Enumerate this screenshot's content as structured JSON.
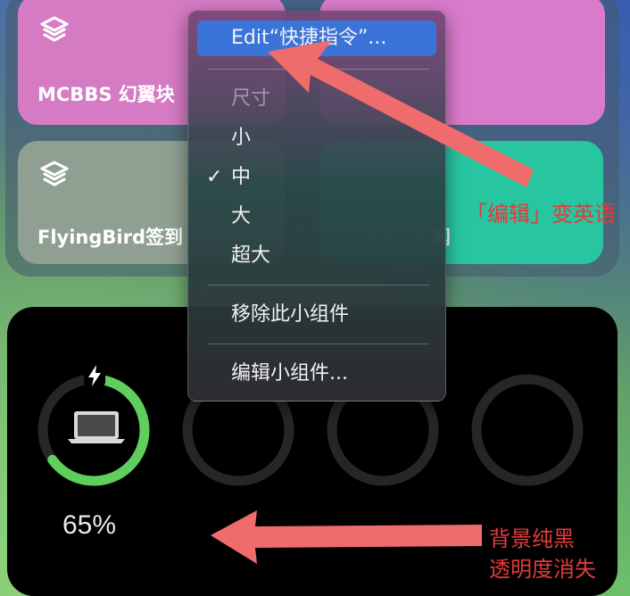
{
  "widgets": {
    "tiles": [
      {
        "id": "mcbbs",
        "title": "MCBBS 幻翼块"
      },
      {
        "id": "flyingbird",
        "title": "FlyingBird签到"
      },
      {
        "id": "news",
        "title": "闻"
      }
    ]
  },
  "battery": {
    "percent_label": "65%",
    "level": 0.65,
    "device_icon": "laptop-icon",
    "charging_icon": "bolt-icon"
  },
  "menu": {
    "edit_label": "Edit“快捷指令”...",
    "size_header": "尺寸",
    "size_small": "小",
    "size_medium": "中",
    "size_large": "大",
    "size_xlarge": "超大",
    "check_mark": "✓",
    "remove_label": "移除此小组件",
    "edit_widgets_label": "编辑小组件..."
  },
  "annotations": {
    "edit_note": "「编辑」变英语",
    "bg_note_line1": "背景纯黑",
    "bg_note_line2": "透明度消失",
    "color": "#e23b3b"
  },
  "colors": {
    "highlight": "#3b74d9",
    "battery_ring": "#5ecf5a",
    "tile_pink": "#d57bc4",
    "tile_teal": "#27c5a0",
    "tile_gray": "#8f9f92"
  }
}
